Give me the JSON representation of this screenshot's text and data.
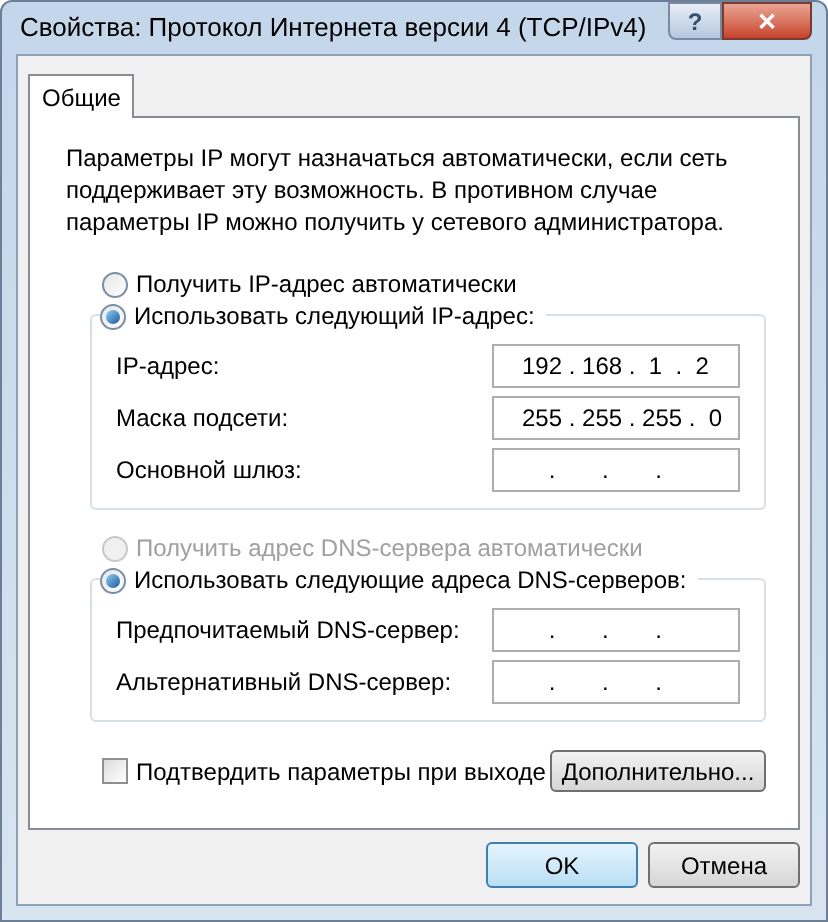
{
  "window": {
    "title": "Свойства: Протокол Интернета версии 4 (TCP/IPv4)",
    "help_button": "?",
    "close_button": "✕"
  },
  "tabs": [
    {
      "label": "Общие",
      "selected": true
    }
  ],
  "description": "Параметры IP могут назначаться автоматически, если сеть поддерживает эту возможность. В противном случае параметры IP можно получить у сетевого администратора.",
  "ip_section": {
    "options": [
      {
        "label": "Получить IP-адрес автоматически",
        "selected": false,
        "disabled": false
      },
      {
        "label": "Использовать следующий IP-адрес:",
        "selected": true,
        "disabled": false
      }
    ],
    "fields": [
      {
        "label": "IP-адрес:",
        "value": "192 . 168 .  1  .  2"
      },
      {
        "label": "Маска подсети:",
        "value": "255 . 255 . 255 .  0"
      },
      {
        "label": "Основной шлюз:",
        "value": "    .       .       ."
      }
    ]
  },
  "dns_section": {
    "options": [
      {
        "label": "Получить адрес DNS-сервера автоматически",
        "selected": false,
        "disabled": true
      },
      {
        "label": "Использовать следующие адреса DNS-серверов:",
        "selected": true,
        "disabled": false
      }
    ],
    "fields": [
      {
        "label": "Предпочитаемый DNS-сервер:",
        "value": "    .       .       ."
      },
      {
        "label": "Альтернативный DNS-сервер:",
        "value": "    .       .       ."
      }
    ]
  },
  "validate_checkbox": {
    "label": "Подтвердить параметры при выходе",
    "checked": false
  },
  "advanced_button": "Дополнительно...",
  "buttons": [
    {
      "label": "OK",
      "default": true
    },
    {
      "label": "Отмена",
      "default": false
    }
  ]
}
